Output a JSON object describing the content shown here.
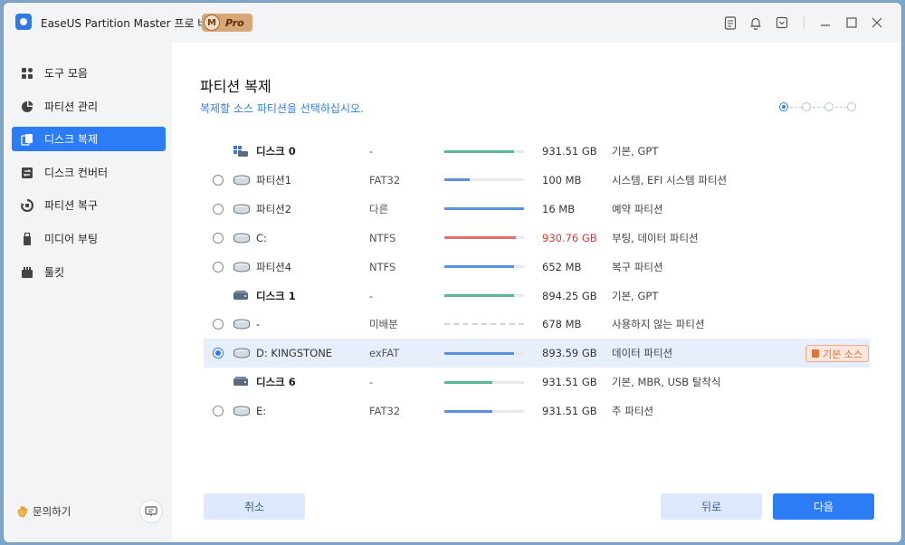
{
  "app": {
    "title": "EaseUS Partition Master 프로 버전",
    "badge_letter": "M",
    "badge_text": "Pro"
  },
  "sidebar": {
    "items": [
      {
        "label": "도구 모음",
        "icon": "toolbox-icon"
      },
      {
        "label": "파티션 관리",
        "icon": "pie-chart-icon"
      },
      {
        "label": "디스크 복제",
        "icon": "clone-icon"
      },
      {
        "label": "디스크 컨버터",
        "icon": "convert-icon"
      },
      {
        "label": "파티션 복구",
        "icon": "recovery-icon"
      },
      {
        "label": "미디어 부팅",
        "icon": "usb-icon"
      },
      {
        "label": "툴킷",
        "icon": "toolkit-icon"
      }
    ],
    "active_index": 2,
    "help_label": "문의하기"
  },
  "main": {
    "title": "파티션 복제",
    "subtitle": "복제할 소스 파티션을 선택하십시오.",
    "steps_total": 4,
    "steps_current": 1
  },
  "rows": [
    {
      "kind": "disk",
      "name": "디스크 0",
      "fs": "-",
      "usage": 0.88,
      "color": "#5bb894",
      "size": "931.51 GB",
      "type": "기본, GPT"
    },
    {
      "kind": "part",
      "name": "파티션1",
      "fs": "FAT32",
      "usage": 0.32,
      "color": "#5b8fe0",
      "size": "100 MB",
      "type": "시스템, EFI 시스템 파티션"
    },
    {
      "kind": "part",
      "name": "파티션2",
      "fs": "다른",
      "usage": 1.0,
      "color": "#5b8fe0",
      "size": "16 MB",
      "type": "예약 파티션"
    },
    {
      "kind": "part",
      "name": "C:",
      "fs": "NTFS",
      "usage": 0.9,
      "color": "#e86f6f",
      "size": "930.76 GB",
      "size_red": true,
      "type": "부팅, 데이터 파티션"
    },
    {
      "kind": "part",
      "name": "파티션4",
      "fs": "NTFS",
      "usage": 0.88,
      "color": "#5b8fe0",
      "size": "652 MB",
      "type": "복구 파티션"
    },
    {
      "kind": "disk",
      "name": "디스크 1",
      "fs": "-",
      "usage": 0.87,
      "color": "#5bb894",
      "size": "894.25 GB",
      "type": "기본, GPT"
    },
    {
      "kind": "part",
      "name": "-",
      "fs": "미배분",
      "usage": 0,
      "color": "#cccccc",
      "dashed": true,
      "size": "678 MB",
      "type": "사용하지 않는 파티션"
    },
    {
      "kind": "part",
      "name": "D: KINGSTONE",
      "fs": "exFAT",
      "usage": 0.87,
      "color": "#5b8fe0",
      "size": "893.59 GB",
      "type": "데이터 파티션",
      "selected": true,
      "tag": "기본 소스"
    },
    {
      "kind": "disk",
      "name": "디스크 6",
      "fs": "-",
      "usage": 0.6,
      "color": "#5bb894",
      "size": "931.51 GB",
      "type": "기본, MBR, USB 탈착식"
    },
    {
      "kind": "part",
      "name": "E:",
      "fs": "FAT32",
      "usage": 0.6,
      "color": "#5b8fe0",
      "size": "931.51 GB",
      "type": "주 파티션"
    }
  ],
  "buttons": {
    "cancel": "취소",
    "back": "뒤로",
    "next": "다음"
  },
  "colors": {
    "accent": "#2c7cf6",
    "disk_bar": "#5bb894",
    "partition_bar": "#5b8fe0",
    "alert_bar": "#e86f6f",
    "alert_text": "#e5352f",
    "tag": "#e3703c"
  }
}
